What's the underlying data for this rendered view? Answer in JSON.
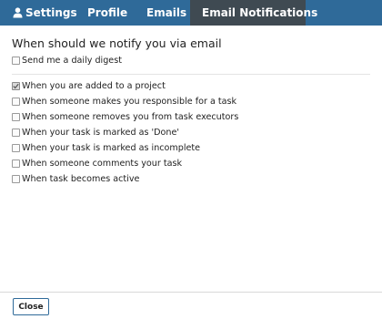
{
  "tabs": [
    {
      "label": "Settings",
      "icon": "user-icon",
      "active": false
    },
    {
      "label": "Profile",
      "active": false
    },
    {
      "label": "Emails",
      "active": false
    },
    {
      "label": "Email Notifications",
      "active": true
    }
  ],
  "main": {
    "title": "When should we notify you via email",
    "daily_digest": {
      "label": "Send me a daily digest",
      "checked": false
    },
    "options": [
      {
        "label": "When you are added to a project",
        "checked": true
      },
      {
        "label": "When someone makes you responsible for a task",
        "checked": false
      },
      {
        "label": "When someone removes you from task executors",
        "checked": false
      },
      {
        "label": "When your task is marked as 'Done'",
        "checked": false
      },
      {
        "label": "When your task is marked as incomplete",
        "checked": false
      },
      {
        "label": "When someone comments your task",
        "checked": false
      },
      {
        "label": "When task becomes active",
        "checked": false
      }
    ]
  },
  "footer": {
    "close_label": "Close"
  },
  "colors": {
    "tabbar": "#2f6a99",
    "active_tab": "#3f4a52",
    "button_border": "#2f6a99"
  }
}
